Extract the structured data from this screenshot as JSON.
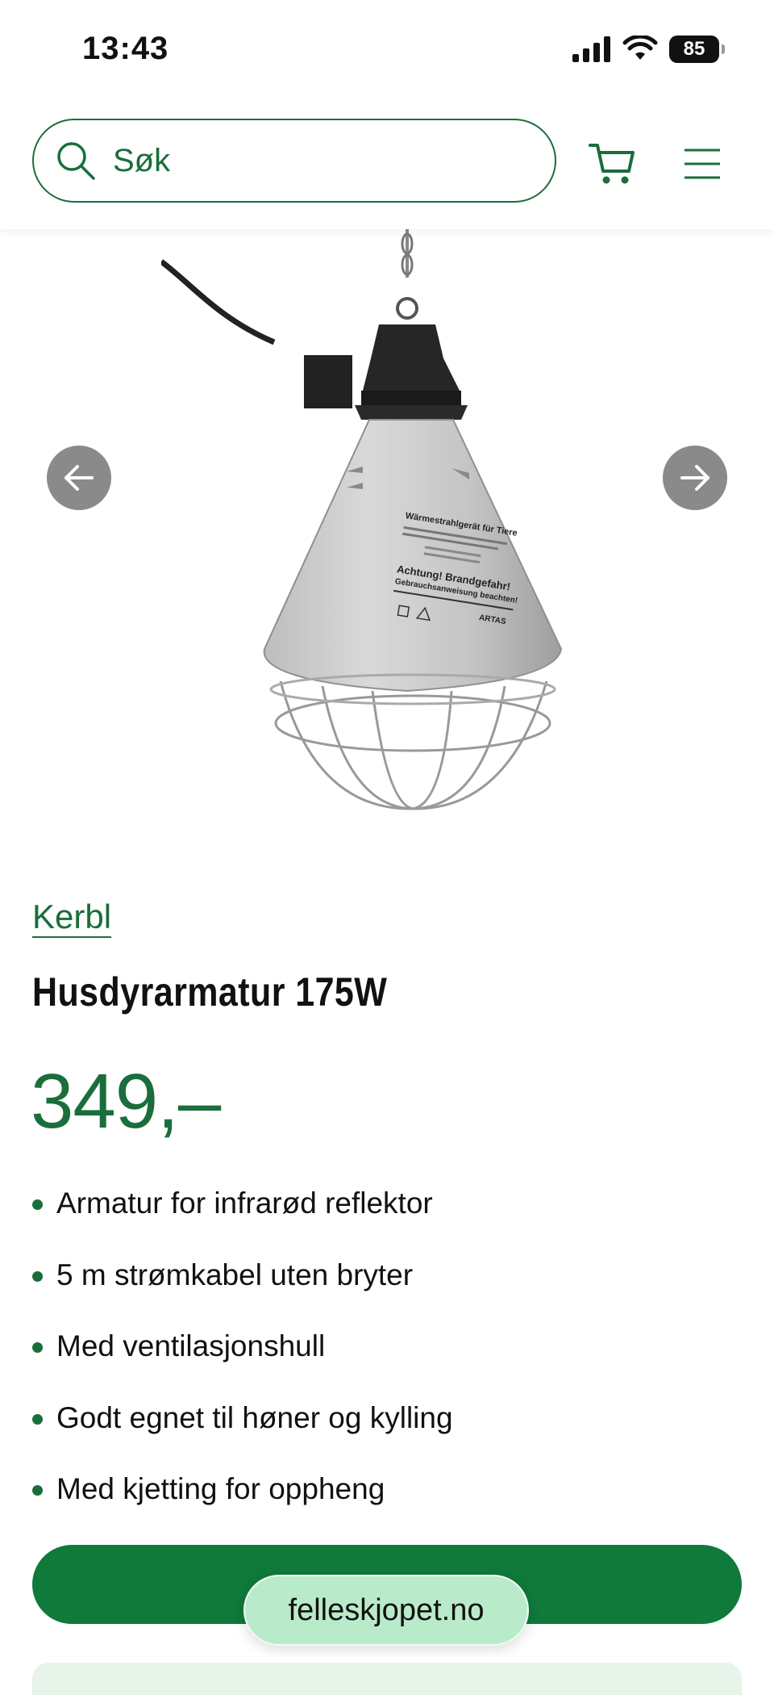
{
  "status_bar": {
    "time": "13:43",
    "battery": "85"
  },
  "header": {
    "search_placeholder": "Søk"
  },
  "product": {
    "brand": "Kerbl",
    "title": "Husdyrarmatur 175W",
    "price": "349,–",
    "features": [
      "Armatur for infrarød reflektor",
      "5 m strømkabel uten bryter",
      "Med ventilasjonshull",
      "Godt egnet til høner og kylling",
      "Med kjetting for oppheng"
    ],
    "image_label": {
      "line1": "Wärmestrahlgerät für Tiere",
      "line2": "Achtung!  Brandgefahr!",
      "line3": "Gebrauchsanweisung beachten!",
      "brand": "ARTAS"
    }
  },
  "browser": {
    "url": "felleskjopet.no"
  },
  "colors": {
    "brand_green": "#1a6e3b",
    "button_green": "#0f7a3a",
    "arrow_gray": "#8a8a8a"
  }
}
